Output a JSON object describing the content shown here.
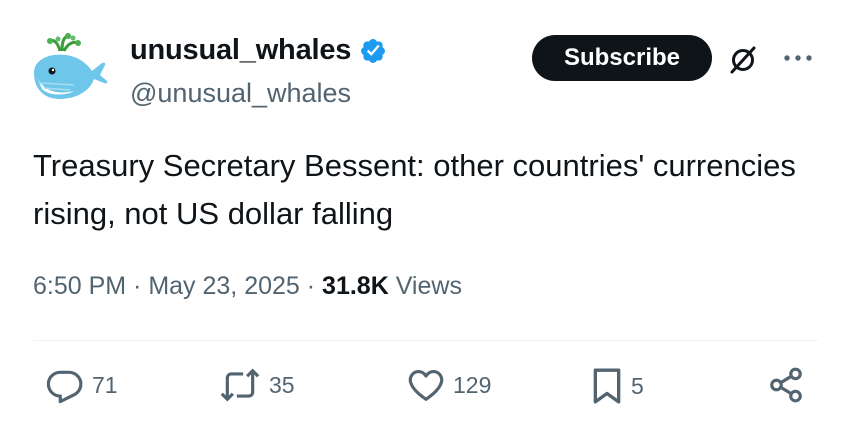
{
  "author": {
    "display_name": "unusual_whales",
    "handle": "@unusual_whales",
    "verified": true,
    "verified_color": "#1d9bf0",
    "avatar_icon": "whale-icon"
  },
  "header": {
    "subscribe_label": "Subscribe",
    "grok_icon": "grok-icon",
    "more_icon": "more-icon"
  },
  "tweet": {
    "text": "Treasury Secretary Bessent: other countries' currencies rising, not US dollar falling",
    "time": "6:50 PM",
    "separator": " · ",
    "date": "May 23, 2025",
    "views_count": "31.8K",
    "views_label": " Views"
  },
  "actions": {
    "replies": "71",
    "retweets": "35",
    "likes": "129",
    "bookmarks": "5"
  },
  "colors": {
    "text": "#0f1419",
    "secondary": "#536471",
    "button_bg": "#0f1419"
  }
}
